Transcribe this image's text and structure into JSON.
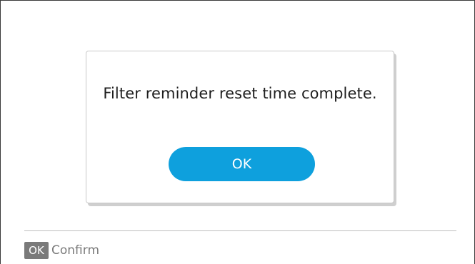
{
  "dialog": {
    "message": "Filter reminder reset time complete.",
    "ok_label": "OK"
  },
  "footer": {
    "key_badge": "OK",
    "hint_label": "Confirm"
  },
  "colors": {
    "accent": "#0ea0dd",
    "badge": "#7a7a7a"
  }
}
